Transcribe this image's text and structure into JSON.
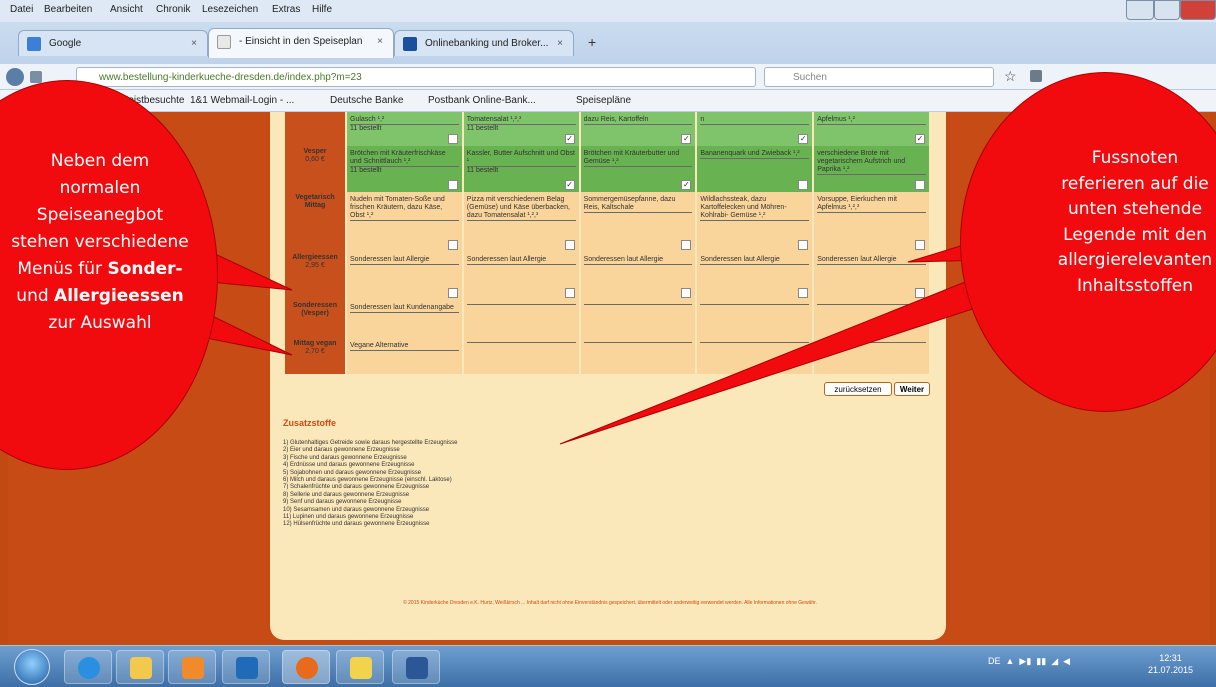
{
  "menubar": [
    "Datei",
    "Bearbeiten",
    "Ansicht",
    "Chronik",
    "Lesezeichen",
    "Extras",
    "Hilfe"
  ],
  "tabs": [
    {
      "label": "Google",
      "active": false
    },
    {
      "label": "- Einsicht in den Speiseplan",
      "active": true
    },
    {
      "label": "Onlinebanking und Broker...",
      "active": false
    }
  ],
  "new_tab": "+",
  "url": "www.bestellung-kinderkueche-dresden.de/index.php?m=23",
  "search_placeholder": "Suchen",
  "bookmarks": [
    "Meistbesuchte",
    "1&1 Webmail-Login - ...",
    "Deutsche Banke",
    "Postbank Online-Bank...",
    "Speisepläne"
  ],
  "rows": [
    {
      "label": "",
      "price": "",
      "dark": false,
      "cells": [
        {
          "text": "Gulasch ¹,²",
          "order": "11 bestellt",
          "check": ""
        },
        {
          "text": "Tomatensalat ¹,²,³",
          "order": "11 bestellt",
          "check": "✓"
        },
        {
          "text": "dazu Reis, Kartoffeln",
          "order": "",
          "check": "✓"
        },
        {
          "text": "n",
          "order": "",
          "check": "✓"
        },
        {
          "text": "Apfelmus ¹,²",
          "order": "",
          "check": "✓"
        }
      ]
    },
    {
      "label": "Vesper",
      "price": "0,60 €",
      "dark": true,
      "cells": [
        {
          "text": "Brötchen mit Kräuterfrischkäse und Schnittlauch ¹,²",
          "order": "11 bestellt",
          "check": ""
        },
        {
          "text": "Kassler, Butter Aufschnitt und Obst ¹",
          "order": "11 bestellt",
          "check": "✓"
        },
        {
          "text": "Brötchen mit Kräuterbutter und Gemüse ¹,²",
          "order": "",
          "check": "✓"
        },
        {
          "text": "Bananenquark und Zwieback ¹,²",
          "order": "",
          "check": ""
        },
        {
          "text": "verschiedene Brote mit vegetarischem Aufstrich und Paprika ¹,²",
          "order": "",
          "check": ""
        }
      ]
    },
    {
      "label": "Vegetarisch Mittag",
      "price": "",
      "dark": false,
      "cells": [
        {
          "text": "Nudeln mit Tomaten-Soße und frischen Kräutern, dazu Käse, Obst ¹,²",
          "order": "",
          "check": ""
        },
        {
          "text": "Pizza mit verschiedenem Belag (Gemüse) und Käse überbacken, dazu Tomatensalat ¹,²,³",
          "order": "",
          "check": ""
        },
        {
          "text": "Sommergemüsepfanne, dazu Reis, Kaltschale",
          "order": "",
          "check": ""
        },
        {
          "text": "Wildlachssteak, dazu Kartoffelecken und Möhren- Kohlrabi- Gemüse ¹,²",
          "order": "",
          "check": ""
        },
        {
          "text": "Vorsuppe, Eierkuchen mit Apfelmus ¹,²,³",
          "order": "",
          "check": ""
        }
      ]
    },
    {
      "label": "Allergieessen",
      "price": "2,95 €",
      "dark": false,
      "cells": [
        {
          "text": "Sonderessen laut Allergie",
          "order": "",
          "check": ""
        },
        {
          "text": "Sonderessen laut Allergie",
          "order": "",
          "check": ""
        },
        {
          "text": "Sonderessen laut Allergie",
          "order": "",
          "check": ""
        },
        {
          "text": "Sonderessen laut Allergie",
          "order": "",
          "check": ""
        },
        {
          "text": "Sonderessen laut Allergie",
          "order": "",
          "check": ""
        }
      ]
    },
    {
      "label": "Sonderessen (Vesper)",
      "price": "",
      "dark": false,
      "cells": [
        {
          "text": "Sonderessen laut Kundenangabe",
          "order": "",
          "check": ""
        },
        {
          "text": "",
          "order": "",
          "check": ""
        },
        {
          "text": "",
          "order": "",
          "check": ""
        },
        {
          "text": "",
          "order": "",
          "check": ""
        },
        {
          "text": "",
          "order": "",
          "check": ""
        }
      ]
    },
    {
      "label": "Mittag vegan",
      "price": "2,70 €",
      "dark": false,
      "cells": [
        {
          "text": "Vegane Alternative",
          "order": "",
          "check": ""
        },
        {
          "text": "",
          "order": "",
          "check": ""
        },
        {
          "text": "",
          "order": "",
          "check": ""
        },
        {
          "text": "",
          "order": "",
          "check": ""
        },
        {
          "text": "",
          "order": "",
          "check": ""
        }
      ]
    }
  ],
  "buttons": {
    "reset": "zurücksetzen",
    "next": "Weiter"
  },
  "legend": {
    "title": "Zusatzstoffe",
    "items": [
      "1) Glutenhaltiges Getreide sowie daraus hergestellte Erzeugnisse",
      "2) Eier und daraus gewonnene Erzeugnisse",
      "3) Fische und daraus gewonnene Erzeugnisse",
      "4) Erdnüsse und daraus gewonnene Erzeugnisse",
      "5) Sojabohnen und daraus gewonnene Erzeugnisse",
      "6) Milch und daraus gewonnene Erzeugnisse (einschl. Laktose)",
      "7) Schalenfrüchte und daraus gewonnene Erzeugnisse",
      "8) Sellerie und daraus gewonnene Erzeugnisse",
      "9) Senf und daraus gewonnene Erzeugnisse",
      "10) Sesamsamen und daraus gewonnene Erzeugnisse",
      "11) Lupinen und daraus gewonnene Erzeugnisse",
      "12) Hülsenfrüchte und daraus gewonnene Erzeugnisse"
    ]
  },
  "footer": "© 2015 Kinderküche Dresden e.K. Hurtz, Weißkirsch ... Inhalt darf nicht ohne Einverständnis gespeichert, übermittelt oder anderweitig verwendet werden. Alle Informationen ohne Gewähr.",
  "callout_left": {
    "line1": "Neben dem",
    "line2": "normalen",
    "line3": "Speiseanegbot",
    "line4": "stehen verschiedene",
    "line5_pre": "Menüs für ",
    "line5_bold": "Sonder-",
    "line6_pre": "und ",
    "line6_bold": "Allergieessen",
    "line7": "zur Auswahl"
  },
  "callout_right": {
    "line1": "Fussnoten",
    "line2": "referieren auf die",
    "line3": "unten stehende",
    "line4": "Legende mit den",
    "line5": "allergierelevanten",
    "line6": "Inhaltsstoffen"
  },
  "taskbar": {
    "lang": "DE",
    "time": "12:31",
    "date": "21.07.2015"
  },
  "colors": {
    "accent": "#c24a12",
    "callout": "#f10b0e",
    "green": "#7fc46a",
    "orange": "#f9d49b"
  }
}
